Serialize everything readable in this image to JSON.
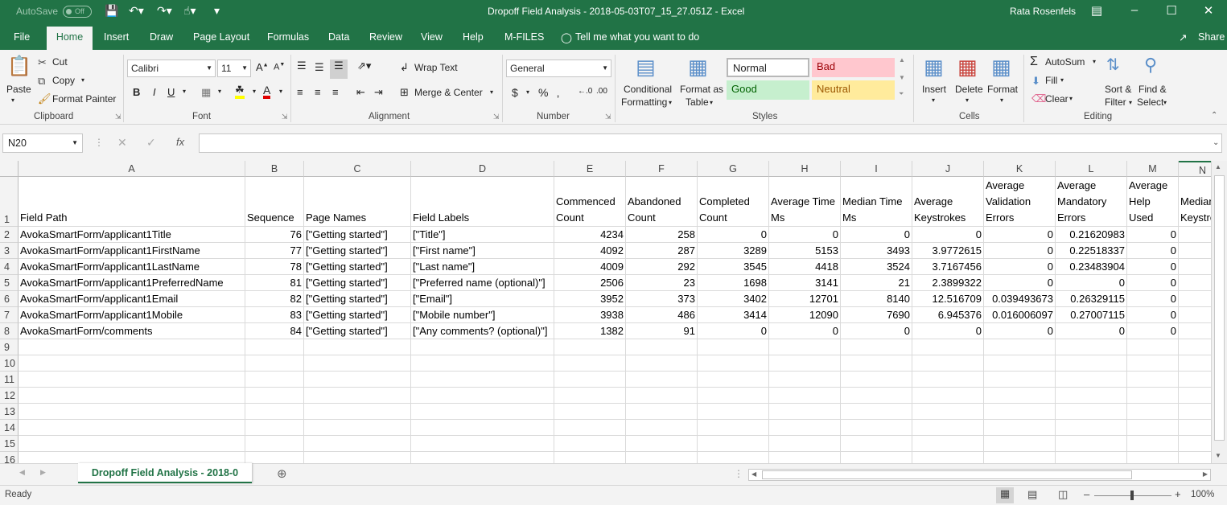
{
  "titlebar": {
    "autosave": "AutoSave",
    "autosave_state": "Off",
    "title": "Dropoff Field Analysis - 2018-05-03T07_15_27.051Z  -  Excel",
    "user": "Rata Rosenfels"
  },
  "tabs": [
    "File",
    "Home",
    "Insert",
    "Draw",
    "Page Layout",
    "Formulas",
    "Data",
    "Review",
    "View",
    "Help",
    "M-FILES"
  ],
  "tell_me": "Tell me what you want to do",
  "share": "Share",
  "ribbon": {
    "clipboard": {
      "paste": "Paste",
      "cut": "Cut",
      "copy": "Copy",
      "format_painter": "Format Painter",
      "label": "Clipboard"
    },
    "font": {
      "name": "Calibri",
      "size": "11",
      "label": "Font"
    },
    "alignment": {
      "wrap_text": "Wrap Text",
      "merge_center": "Merge & Center",
      "label": "Alignment"
    },
    "number": {
      "format": "General",
      "label": "Number"
    },
    "styles": {
      "conditional_1": "Conditional",
      "conditional_2": "Formatting",
      "format_table_1": "Format as",
      "format_table_2": "Table",
      "normal": "Normal",
      "bad": "Bad",
      "good": "Good",
      "neutral": "Neutral",
      "label": "Styles"
    },
    "cells": {
      "insert": "Insert",
      "delete": "Delete",
      "format": "Format",
      "label": "Cells"
    },
    "editing": {
      "autosum": "AutoSum",
      "fill": "Fill",
      "clear": "Clear",
      "sort_1": "Sort &",
      "sort_2": "Filter",
      "find_1": "Find &",
      "find_2": "Select",
      "label": "Editing"
    }
  },
  "namebox": "N20",
  "columns": [
    "A",
    "B",
    "C",
    "D",
    "E",
    "F",
    "G",
    "H",
    "I",
    "J",
    "K",
    "L",
    "M",
    "N"
  ],
  "rows": [
    [
      "Field Path",
      "Sequence",
      "Page Names",
      "Field Labels",
      "Commenced Count",
      "Abandoned Count",
      "Completed Count",
      "Average Time Ms",
      "Median Time Ms",
      "Average Keystrokes",
      "Average Validation Errors",
      "Average Mandatory Errors",
      "Average Help Used",
      "Median Keystrokes"
    ],
    [
      "AvokaSmartForm/applicant1Title",
      "76",
      "[\"Getting started\"]",
      "[\"Title\"]",
      "4234",
      "258",
      "0",
      "0",
      "0",
      "0",
      "0",
      "0.21620983",
      "0",
      ""
    ],
    [
      "AvokaSmartForm/applicant1FirstName",
      "77",
      "[\"Getting started\"]",
      "[\"First name\"]",
      "4092",
      "287",
      "3289",
      "5153",
      "3493",
      "3.9772615",
      "0",
      "0.22518337",
      "0",
      ""
    ],
    [
      "AvokaSmartForm/applicant1LastName",
      "78",
      "[\"Getting started\"]",
      "[\"Last name\"]",
      "4009",
      "292",
      "3545",
      "4418",
      "3524",
      "3.7167456",
      "0",
      "0.23483904",
      "0",
      ""
    ],
    [
      "AvokaSmartForm/applicant1PreferredName",
      "81",
      "[\"Getting started\"]",
      "[\"Preferred name (optional)\"]",
      "2506",
      "23",
      "1698",
      "3141",
      "21",
      "2.3899322",
      "0",
      "0",
      "0",
      ""
    ],
    [
      "AvokaSmartForm/applicant1Email",
      "82",
      "[\"Getting started\"]",
      "[\"Email\"]",
      "3952",
      "373",
      "3402",
      "12701",
      "8140",
      "12.516709",
      "0.039493673",
      "0.26329115",
      "0",
      ""
    ],
    [
      "AvokaSmartForm/applicant1Mobile",
      "83",
      "[\"Getting started\"]",
      "[\"Mobile number\"]",
      "3938",
      "486",
      "3414",
      "12090",
      "7690",
      "6.945376",
      "0.016006097",
      "0.27007115",
      "0",
      ""
    ],
    [
      "AvokaSmartForm/comments",
      "84",
      "[\"Getting started\"]",
      "[\"Any comments? (optional)\"]",
      "1382",
      "91",
      "0",
      "0",
      "0",
      "0",
      "0",
      "0",
      "0",
      ""
    ]
  ],
  "row_numbers": [
    "1",
    "2",
    "3",
    "4",
    "5",
    "6",
    "7",
    "8",
    "9",
    "10",
    "11",
    "12",
    "13",
    "14",
    "15",
    "16"
  ],
  "sheet_tab": "Dropoff Field Analysis - 2018-0",
  "status": {
    "ready": "Ready",
    "zoom": "100%"
  },
  "colors": {
    "excel_green": "#217346",
    "bad_bg": "#ffc7ce",
    "good_bg": "#c6efce",
    "neutral_bg": "#ffeb9c"
  }
}
